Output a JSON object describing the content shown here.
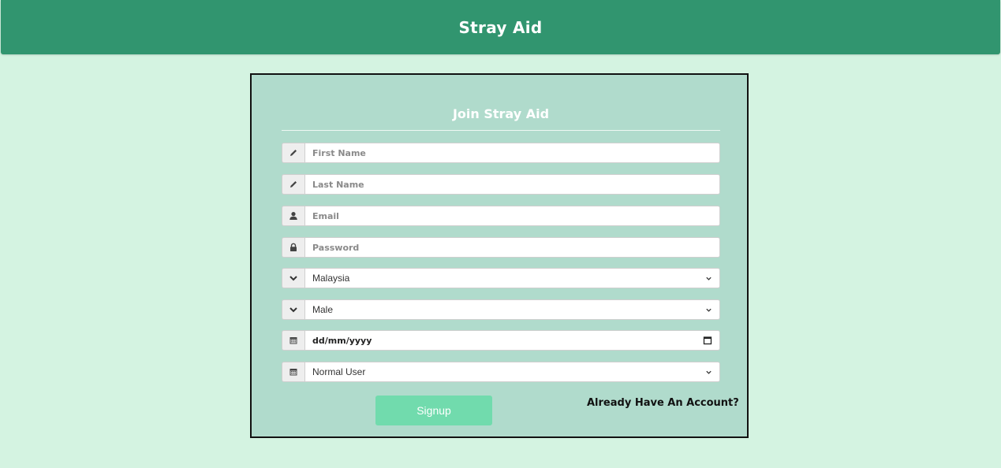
{
  "header": {
    "brand": "Stray Aid"
  },
  "form": {
    "title": "Join Stray Aid",
    "fields": {
      "first_name": {
        "placeholder": "First Name",
        "icon": "pencil-icon"
      },
      "last_name": {
        "placeholder": "Last Name",
        "icon": "pencil-icon"
      },
      "email": {
        "placeholder": "Email",
        "icon": "user-icon"
      },
      "password": {
        "placeholder": "Password",
        "icon": "lock-icon"
      },
      "country": {
        "value": "Malaysia",
        "icon": "chevron-down-icon"
      },
      "gender": {
        "value": "Male",
        "icon": "chevron-down-icon"
      },
      "birthdate": {
        "value": "dd/mm/yyyy",
        "icon": "calendar-icon"
      },
      "user_type": {
        "value": "Normal User",
        "icon": "calendar-icon"
      }
    },
    "signup_label": "Signup",
    "login_link": "Already Have An Account?"
  },
  "colors": {
    "header_bg": "#31956f",
    "page_bg": "#d4f3e1",
    "card_bg": "#b0dbcc",
    "signup_bg": "#71dbad"
  }
}
